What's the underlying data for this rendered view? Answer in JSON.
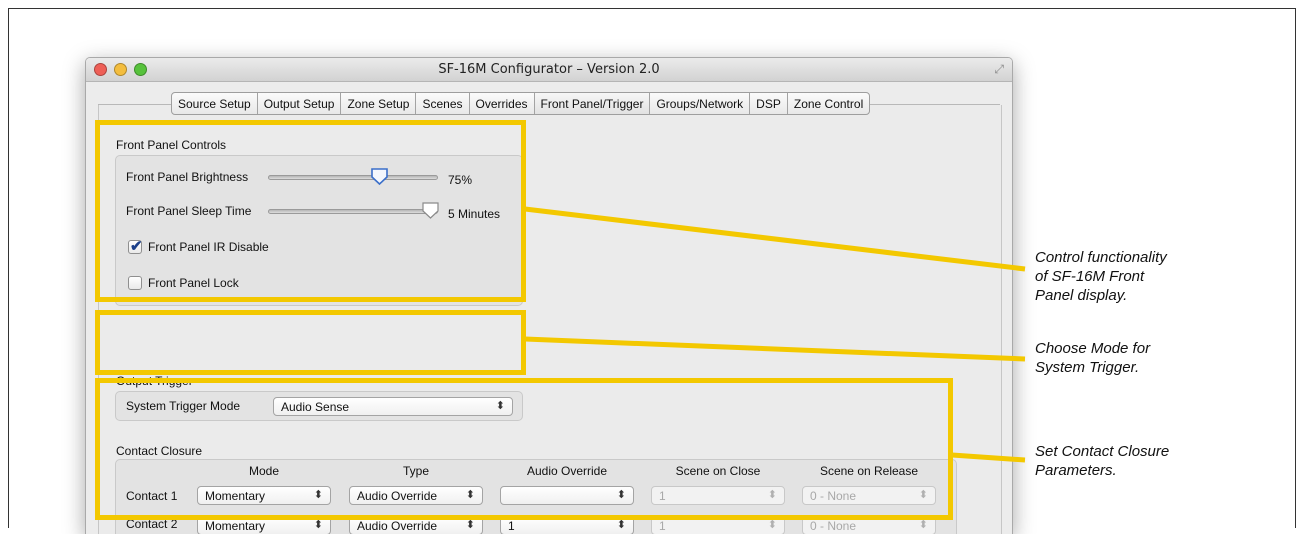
{
  "window": {
    "title": "SF-16M Configurator – Version 2.0",
    "traffic_colors": [
      "#ee5f57",
      "#f3bd3e",
      "#57c23c"
    ]
  },
  "tabs": [
    {
      "label": "Source Setup"
    },
    {
      "label": "Output Setup"
    },
    {
      "label": "Zone Setup"
    },
    {
      "label": "Scenes"
    },
    {
      "label": "Overrides"
    },
    {
      "label": "Front Panel/Trigger"
    },
    {
      "label": "Groups/Network"
    },
    {
      "label": "DSP"
    },
    {
      "label": "Zone Control"
    }
  ],
  "active_tab": "Front Panel/Trigger",
  "front_panel": {
    "title": "Front Panel Controls",
    "brightness_label": "Front Panel Brightness",
    "brightness_value": "75%",
    "brightness_fraction": 0.75,
    "sleep_label": "Front Panel Sleep Time",
    "sleep_value": "5 Minutes",
    "sleep_fraction": 1.0,
    "ir_disable_label": "Front Panel IR Disable",
    "ir_disable_checked": true,
    "lock_label": "Front Panel Lock",
    "lock_checked": false
  },
  "output_trigger": {
    "title": "Output Trigger",
    "mode_label": "System Trigger Mode",
    "mode_value": "Audio Sense"
  },
  "contact_closure": {
    "title": "Contact Closure",
    "columns": [
      "Mode",
      "Type",
      "Audio Override",
      "Scene on Close",
      "Scene on Release"
    ],
    "rows": [
      {
        "label": "Contact 1",
        "mode": "Momentary",
        "type": "Audio Override",
        "audio_override": "",
        "scene_on_close": "1",
        "scene_on_release": "0 - None"
      },
      {
        "label": "Contact 2",
        "mode": "Momentary",
        "type": "Audio Override",
        "audio_override": "1",
        "scene_on_close": "1",
        "scene_on_release": "0 - None"
      }
    ]
  },
  "callouts": {
    "front_panel": [
      "Control functionality",
      "of SF-16M Front",
      "Panel display."
    ],
    "trigger": [
      "Choose Mode for",
      "System Trigger."
    ],
    "contact": [
      "Set Contact Closure",
      "Parameters."
    ]
  },
  "colors": {
    "highlight": "#f3c800",
    "checkmark": "#1b3f8a",
    "knob_outline": "#3b6fc9"
  },
  "icons": {
    "stepper": "updown-arrows-icon",
    "resize": "fullscreen-icon"
  }
}
